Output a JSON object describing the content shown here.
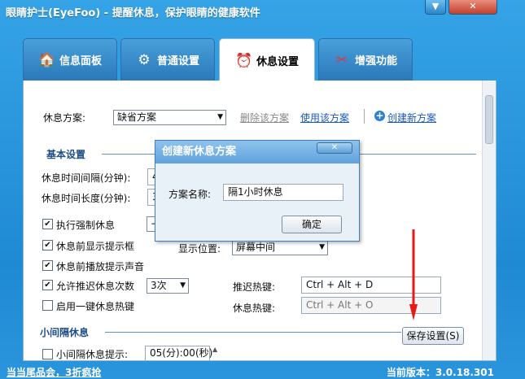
{
  "window": {
    "title": "眼睛护士(EyeFoo) - 提醒休息，保护眼睛的健康软件",
    "minimize_label": "▼",
    "close_label": "✕"
  },
  "tabs": [
    {
      "label": "信息面板",
      "icon": "house-icon"
    },
    {
      "label": "普通设置",
      "icon": "gears-icon"
    },
    {
      "label": "休息设置",
      "icon": "alarm-clock-icon"
    },
    {
      "label": "增强功能",
      "icon": "swiss-knife-icon"
    }
  ],
  "plan": {
    "label": "休息方案:",
    "selected": "缺省方案",
    "delete_link": "删除该方案",
    "use_link": "使用该方案",
    "create_link": "创建新方案"
  },
  "basic": {
    "title": "基本设置",
    "interval_label": "休息时间间隔(分钟):",
    "interval_value": "4",
    "duration_label": "休息时间长度(分钟):",
    "duration_value": "3",
    "force_rest": "执行强制休息",
    "show_tip_box": "休息前显示提示框",
    "position_label": "显示位置:",
    "position_value": "屏幕中间",
    "play_sound": "休息前播放提示声音",
    "allow_delay": "允许推迟休息次数",
    "delay_count": "3次",
    "delay_hotkey_label": "推迟热键:",
    "delay_hotkey_value": "Ctrl + Alt + D",
    "onekey_rest": "启用一键休息热键",
    "rest_hotkey_label": "休息热键:",
    "rest_hotkey_value": "Ctrl + Alt + O"
  },
  "small": {
    "title": "小间隔休息",
    "tip_label": "小间隔休息提示:",
    "tip_value": "05(分):00(秒)"
  },
  "save_button": "保存设置(S)",
  "dialog": {
    "title": "创建新休息方案",
    "name_label": "方案名称:",
    "name_value": "隔1小时休息",
    "ok_button": "确定"
  },
  "status": {
    "left": "当当尾品会，3折疯抢",
    "right": "当前版本：3.0.18.301"
  },
  "colors": {
    "accent": "#2a8fd6",
    "arrow": "#e41b1b"
  }
}
